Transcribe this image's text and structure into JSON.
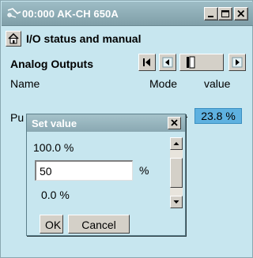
{
  "window": {
    "title": "00:000 AK-CH 650A"
  },
  "page": {
    "title": "I/O status and manual",
    "section": "Analog Outputs"
  },
  "table": {
    "columns": [
      "Name",
      "Mode",
      "value"
    ],
    "row": {
      "name_visible": "Pu",
      "mode_visible": "-",
      "value": "23.8 %"
    }
  },
  "dialog": {
    "title": "Set value",
    "max_label": "100.0 %",
    "input_value": "50",
    "unit": "%",
    "min_label": "0.0 %",
    "ok_label": "OK",
    "cancel_label": "Cancel",
    "slider_level_percent": 50
  },
  "colors": {
    "background": "#c7e6ef",
    "title_bar": "#8aa8b2",
    "value_highlight": "#5eb1e0"
  },
  "icons": {
    "app": "app-icon",
    "home": "home-icon",
    "minimize": "minimize-icon",
    "maximize": "maximize-icon",
    "close": "close-icon",
    "nav_first": "first-page-icon",
    "nav_prev": "prev-page-icon",
    "nav_position": "page-position-icon",
    "nav_next": "next-page-icon",
    "scroll_up": "scroll-up-icon",
    "scroll_down": "scroll-down-icon"
  }
}
